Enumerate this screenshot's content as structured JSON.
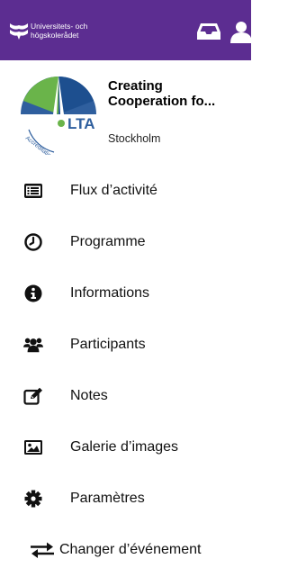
{
  "header": {
    "org_name": "Universitets- och\nhögskolerådet",
    "inbox_icon": "inbox-icon",
    "profile_icon": "user-icon",
    "bg_color": "#5c2d91"
  },
  "event": {
    "title_line1": "Creating",
    "title_line2": "Cooperation fo...",
    "city": "Stockholm",
    "logo_text": "LTA",
    "logo_arc_text": "Accreditation"
  },
  "menu": {
    "items": [
      {
        "label": "Flux d’activité",
        "icon": "activity-feed-icon"
      },
      {
        "label": "Programme",
        "icon": "clock-icon"
      },
      {
        "label": "Informations",
        "icon": "info-icon"
      },
      {
        "label": "Participants",
        "icon": "users-icon"
      },
      {
        "label": "Notes",
        "icon": "edit-note-icon"
      },
      {
        "label": "Galerie d’images",
        "icon": "image-gallery-icon"
      },
      {
        "label": "Paramètres",
        "icon": "gear-icon"
      },
      {
        "label": "Changer d’événement",
        "icon": "swap-arrows-icon"
      }
    ]
  }
}
